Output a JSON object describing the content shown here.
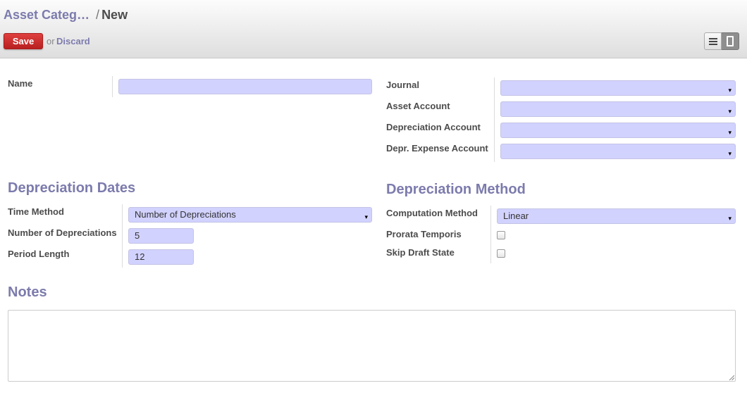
{
  "breadcrumb": {
    "parent": "Asset Categ…",
    "separator": "/",
    "current": "New"
  },
  "toolbar": {
    "save_label": "Save",
    "or_text": "or",
    "discard_label": "Discard",
    "views": [
      "list-view-icon",
      "form-view-icon"
    ]
  },
  "form": {
    "name": {
      "label": "Name",
      "value": ""
    },
    "journal": {
      "label": "Journal",
      "value": ""
    },
    "asset_account": {
      "label": "Asset Account",
      "value": ""
    },
    "depreciation_account": {
      "label": "Depreciation Account",
      "value": ""
    },
    "expense_account": {
      "label": "Depr. Expense Account",
      "value": ""
    },
    "dates_section": {
      "title": "Depreciation Dates",
      "time_method": {
        "label": "Time Method",
        "value": "Number of Depreciations"
      },
      "num_depreciations": {
        "label": "Number of Depreciations",
        "value": "5"
      },
      "period_length": {
        "label": "Period Length",
        "value": "12"
      }
    },
    "method_section": {
      "title": "Depreciation Method",
      "computation_method": {
        "label": "Computation Method",
        "value": "Linear"
      },
      "prorata": {
        "label": "Prorata Temporis",
        "checked": false
      },
      "skip_draft": {
        "label": "Skip Draft State",
        "checked": false
      }
    },
    "notes": {
      "title": "Notes",
      "value": ""
    }
  },
  "colors": {
    "accent": "#7c7bad",
    "input_bg": "#d2d2ff",
    "save_bg": "#c9302c"
  },
  "caret_glyph": "▾"
}
